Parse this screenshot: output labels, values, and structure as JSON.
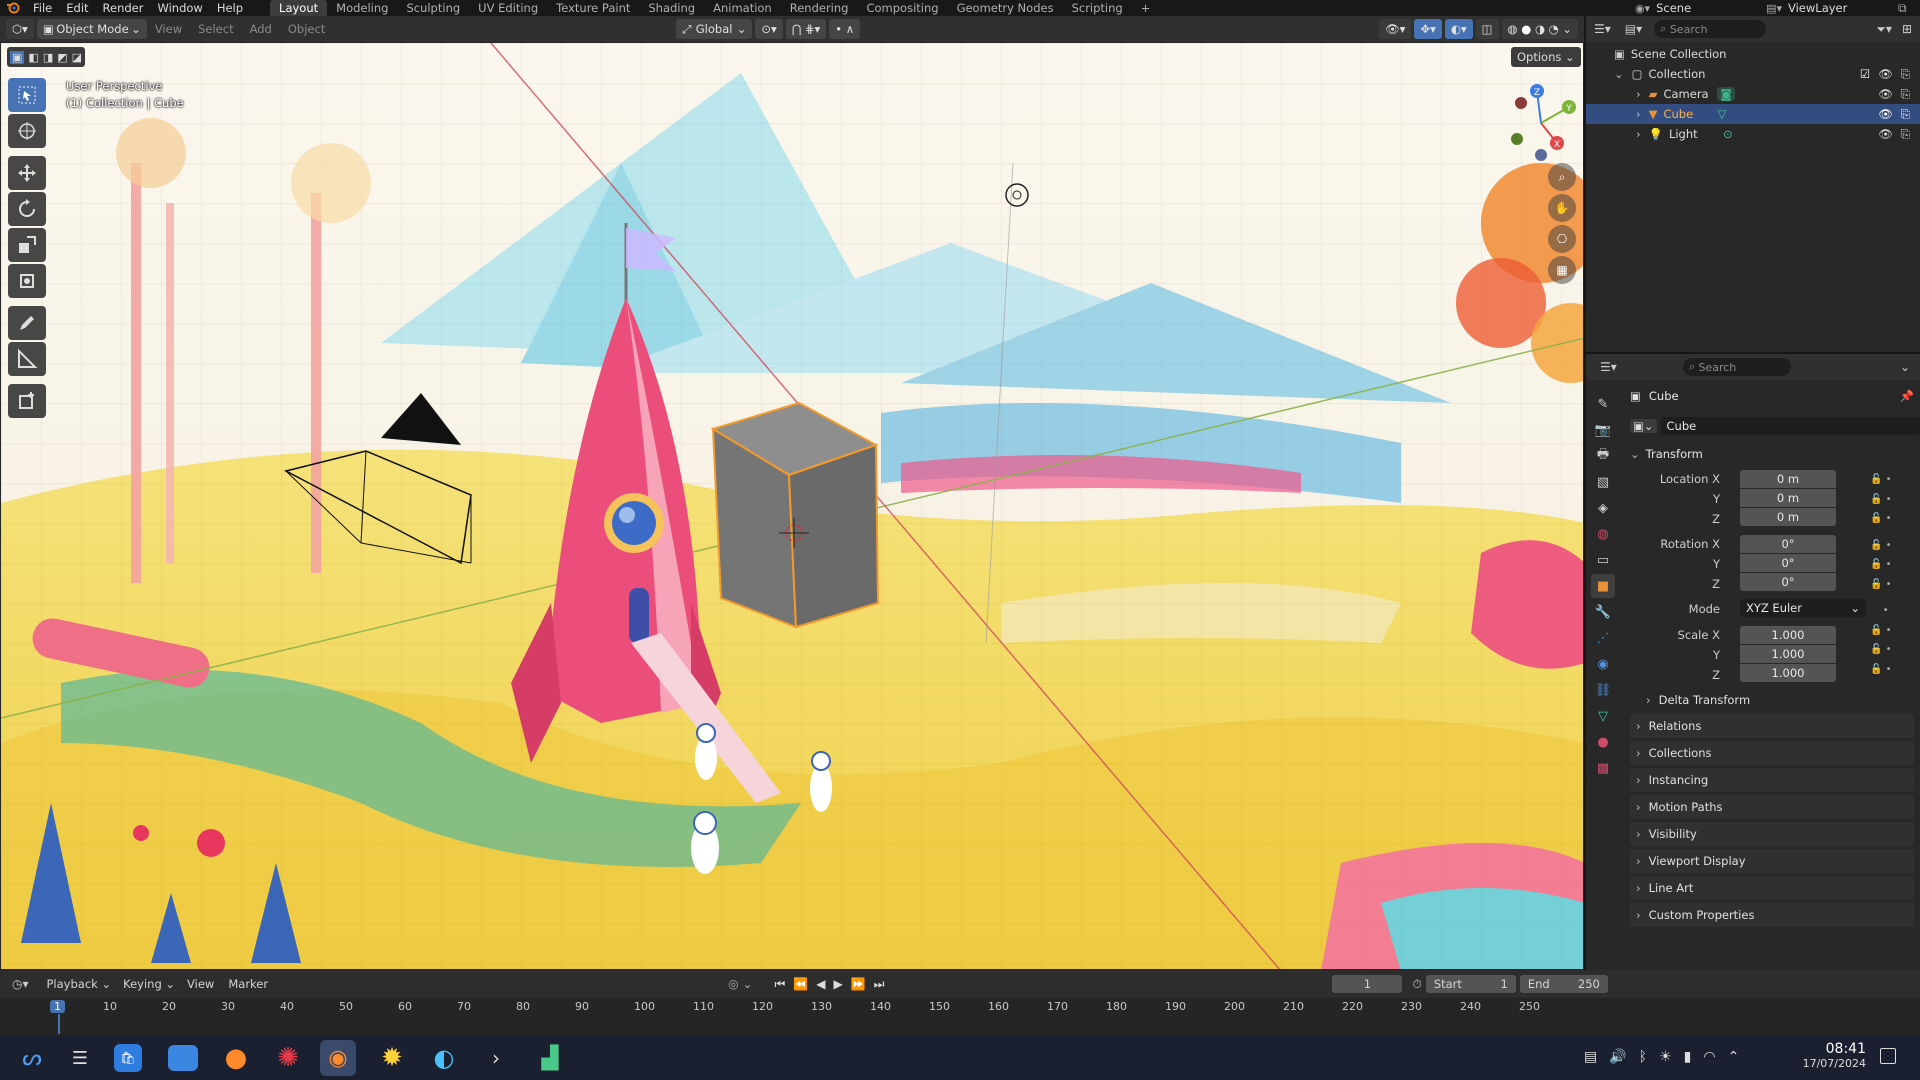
{
  "topbar": {
    "menus": [
      "File",
      "Edit",
      "Render",
      "Window",
      "Help"
    ],
    "workspaces": [
      "Layout",
      "Modeling",
      "Sculpting",
      "UV Editing",
      "Texture Paint",
      "Shading",
      "Animation",
      "Rendering",
      "Compositing",
      "Geometry Nodes",
      "Scripting"
    ],
    "active_workspace": "Layout",
    "add_tab": "+",
    "scene": "Scene",
    "view_layer": "ViewLayer"
  },
  "viewport_header": {
    "mode": "Object Mode",
    "menus": [
      "View",
      "Select",
      "Add",
      "Object"
    ],
    "orientation": "Global",
    "options": "Options"
  },
  "viewport": {
    "perspective_label": "User Perspective",
    "collection_label": "(1) Collection | Cube",
    "gizmo_axes": [
      "X",
      "Y",
      "Z"
    ]
  },
  "outliner": {
    "search_placeholder": "Search",
    "items": [
      {
        "label": "Scene Collection"
      },
      {
        "label": "Collection"
      },
      {
        "label": "Camera"
      },
      {
        "label": "Cube"
      },
      {
        "label": "Light"
      }
    ],
    "selected": "Cube"
  },
  "properties": {
    "search_placeholder": "Search",
    "object_name": "Cube",
    "datablock_name": "Cube",
    "transform_title": "Transform",
    "location": {
      "label": "Location X",
      "x": "0 m",
      "y": "0 m",
      "z": "0 m"
    },
    "rotation": {
      "label": "Rotation X",
      "x": "0°",
      "y": "0°",
      "z": "0°"
    },
    "mode_label": "Mode",
    "mode_value": "XYZ Euler",
    "scale": {
      "label": "Scale X",
      "x": "1.000",
      "y": "1.000",
      "z": "1.000"
    },
    "axis_y": "Y",
    "axis_z": "Z",
    "delta_transform": "Delta Transform",
    "panels": [
      "Relations",
      "Collections",
      "Instancing",
      "Motion Paths",
      "Visibility",
      "Viewport Display",
      "Line Art",
      "Custom Properties"
    ]
  },
  "timeline": {
    "menus": [
      "Playback",
      "Keying",
      "View",
      "Marker"
    ],
    "current_frame": "1",
    "start_label": "Start",
    "start_value": "1",
    "end_label": "End",
    "end_value": "250",
    "ruler": [
      "1",
      "10",
      "20",
      "30",
      "40",
      "50",
      "60",
      "70",
      "80",
      "90",
      "100",
      "110",
      "120",
      "130",
      "140",
      "150",
      "160",
      "170",
      "180",
      "190",
      "200",
      "210",
      "220",
      "230",
      "240",
      "250"
    ]
  },
  "taskbar": {
    "time": "08:41",
    "date": "17/07/2024"
  },
  "colors": {
    "accent": "#4772b3",
    "selection": "#334d80",
    "sky": "#f6f0e6",
    "ground": "#f2d65a",
    "rocket": "#e94d76",
    "cube": "#7a7a7a",
    "outline": "#f09030"
  }
}
